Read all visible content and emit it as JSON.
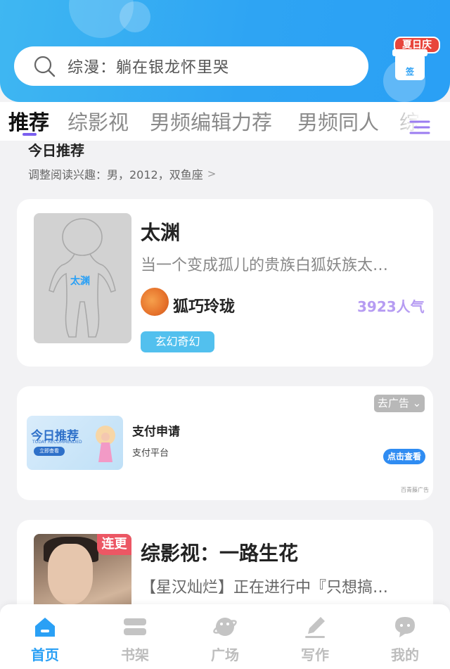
{
  "search": {
    "placeholder_text": "综漫：躺在银龙怀里哭"
  },
  "checkin": {
    "badge": "夏日庆",
    "label": "签"
  },
  "tabs": [
    {
      "label": "推荐",
      "active": true
    },
    {
      "label": "综影视"
    },
    {
      "label": "男频编辑力荐"
    },
    {
      "label": "男频同人"
    },
    {
      "label": "综漫"
    }
  ],
  "recommend": {
    "title": "今日推荐",
    "interest": "调整阅读兴趣：男，2012，双鱼座",
    "interest_chevron": ">"
  },
  "book1": {
    "cover_label": "太渊",
    "title": "太渊",
    "description": "当一个变成孤儿的贵族白狐妖族太…",
    "author": "狐巧玲珑",
    "popularity": "3923人气",
    "genre": "玄幻奇幻"
  },
  "ad": {
    "close_label": "去广告",
    "image_title": "今日推荐",
    "image_subtitle": "TODAY RECOMMENDED",
    "image_button": "立即查看",
    "title": "支付申请",
    "subtitle": "支付平台",
    "button": "点击查看",
    "source": "百青藤广告"
  },
  "book2": {
    "badge": "连更",
    "title": "综影视：一路生花",
    "description": "【星汉灿烂】正在进行中『只想搞…"
  },
  "bottom_nav": [
    {
      "label": "首页",
      "icon": "home-icon",
      "active": true
    },
    {
      "label": "书架",
      "icon": "bookshelf-icon"
    },
    {
      "label": "广场",
      "icon": "planet-icon"
    },
    {
      "label": "写作",
      "icon": "pen-icon"
    },
    {
      "label": "我的",
      "icon": "chat-face-icon"
    }
  ],
  "colors": {
    "primary": "#2aa0f5",
    "tag": "#52c0ee",
    "popularity": "#b69cf2",
    "badge": "#ec5764"
  }
}
